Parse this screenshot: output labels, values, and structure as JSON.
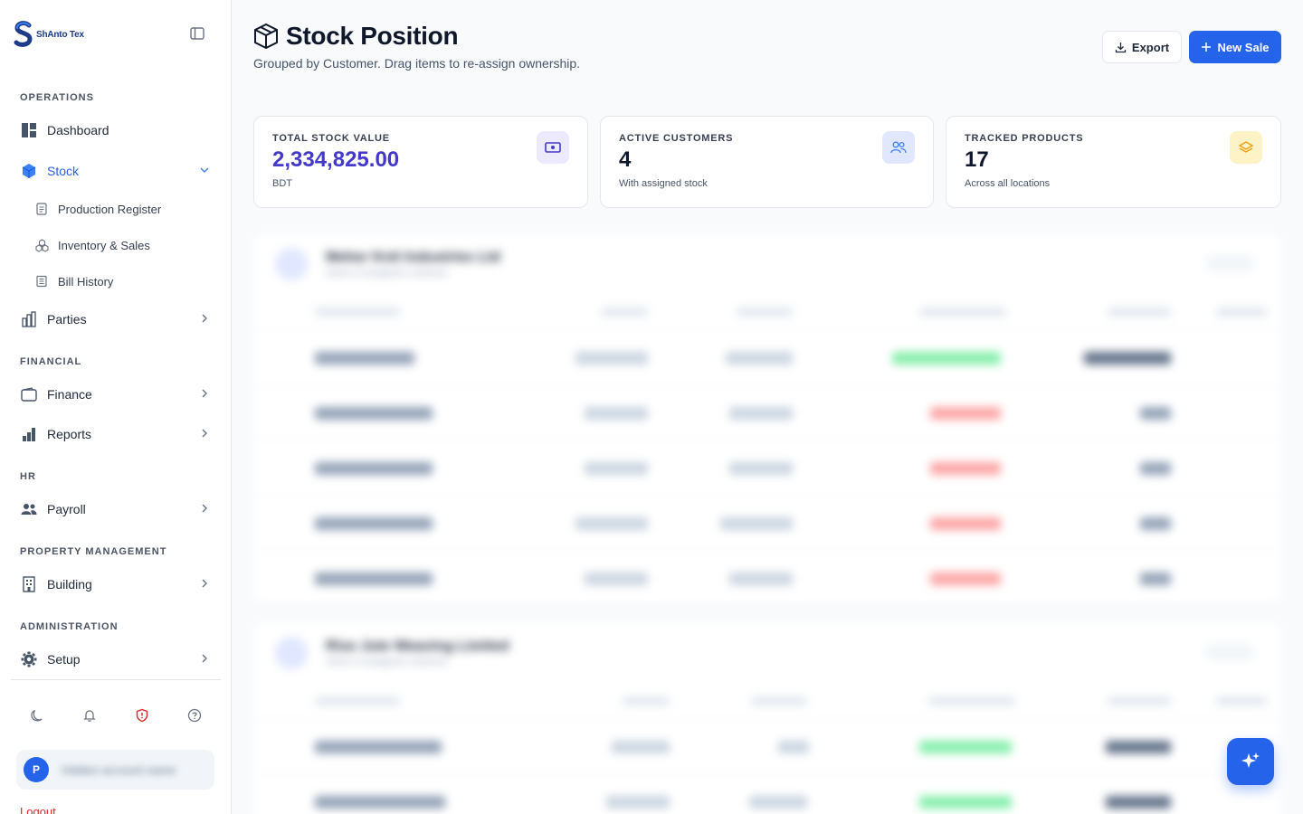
{
  "brand": {
    "name": "ShAnto Tex"
  },
  "sidebar": {
    "sections": {
      "operations": "OPERATIONS",
      "financial": "FINANCIAL",
      "hr": "HR",
      "property": "PROPERTY MANAGEMENT",
      "admin": "ADMINISTRATION"
    },
    "items": {
      "dashboard": "Dashboard",
      "stock": "Stock",
      "production_register": "Production Register",
      "inventory_sales": "Inventory & Sales",
      "bill_history": "Bill History",
      "parties": "Parties",
      "finance": "Finance",
      "reports": "Reports",
      "payroll": "Payroll",
      "building": "Building",
      "setup": "Setup"
    },
    "user": {
      "initial": "P",
      "name": "Hidden account name"
    },
    "logout": "Logout"
  },
  "header": {
    "title": "Stock Position",
    "subtitle": "Grouped by Customer. Drag items to re-assign ownership.",
    "export_label": "Export",
    "new_sale_label": "New Sale"
  },
  "stats": [
    {
      "label": "TOTAL STOCK VALUE",
      "value": "2,334,825.00",
      "foot": "BDT",
      "icon": "banknote-icon",
      "icon_bg": "#ede9fe",
      "icon_color": "#4338ca"
    },
    {
      "label": "ACTIVE CUSTOMERS",
      "value": "4",
      "foot": "With assigned stock",
      "icon": "users-icon",
      "icon_bg": "#e0e7ff",
      "icon_color": "#3b82f6"
    },
    {
      "label": "TRACKED PRODUCTS",
      "value": "17",
      "foot": "Across all locations",
      "icon": "layers-icon",
      "icon_bg": "#fef3c7",
      "icon_color": "#f59e0b"
    }
  ],
  "groups": [
    {
      "title": "Meher Knit Industries Ltd",
      "subtitle": "Stock of assigned customer"
    },
    {
      "title": "Rise Jute Weaving Limited",
      "subtitle": "Stock of assigned customer"
    }
  ],
  "colors": {
    "primary": "#2563eb",
    "accent": "#4338ca"
  }
}
